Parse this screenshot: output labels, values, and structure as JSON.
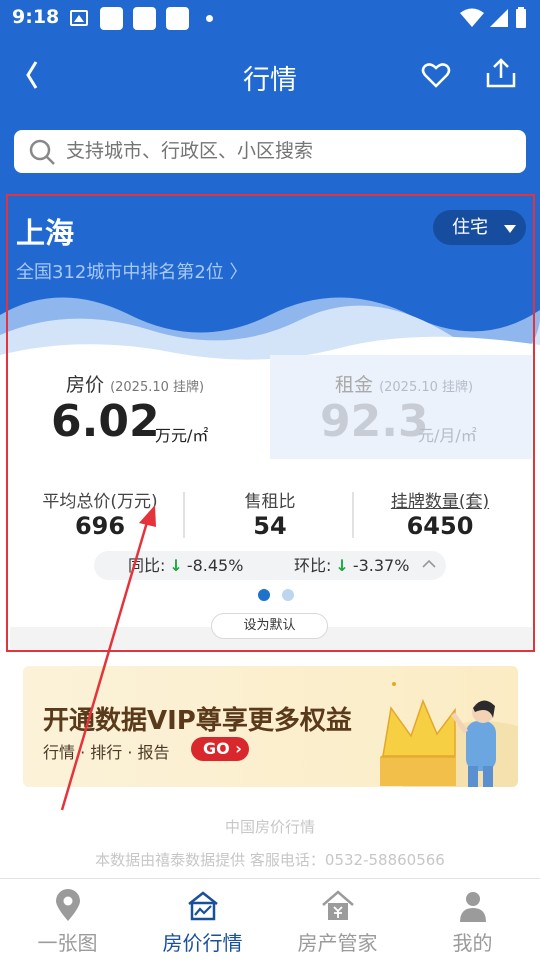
{
  "status_bar": {
    "time": "9:18"
  },
  "nav": {
    "title": "行情"
  },
  "search": {
    "placeholder": "支持城市、行政区、小区搜索"
  },
  "card": {
    "city": "上海",
    "rank_text": "全国312城市中排名第2位 〉",
    "property_type": "住宅",
    "price": {
      "label": "房价",
      "date": "(2025.10 挂牌)",
      "value": "6.02",
      "unit": "万元/㎡"
    },
    "rent": {
      "label": "租金",
      "date": "(2025.10 挂牌)",
      "value": "92.3",
      "unit": "元/月/㎡"
    },
    "stats": [
      {
        "label": "平均总价(万元)",
        "value": "696"
      },
      {
        "label": "售租比",
        "value": "54"
      },
      {
        "label": "挂牌数量(套)",
        "value": "6450"
      }
    ],
    "yoy": {
      "label": "同比:",
      "value": "-8.45%"
    },
    "mom": {
      "label": "环比:",
      "value": "-3.37%"
    },
    "pager": {
      "pages": 2,
      "active": 1
    },
    "set_default": "设为默认"
  },
  "vip_banner": {
    "title_plain": "开通数据VIP",
    "title_highlight": "尊享更多权益",
    "subtitle": "行情 · 排行 · 报告",
    "go": "GO"
  },
  "footer": {
    "name": "中国房价行情",
    "info": "本数据由禧泰数据提供 客服电话：0532-58860566"
  },
  "tabs": [
    {
      "label": "一张图",
      "icon": "location-pin-icon",
      "active": false
    },
    {
      "label": "房价行情",
      "icon": "house-chart-icon",
      "active": true
    },
    {
      "label": "房产管家",
      "icon": "house-yen-icon",
      "active": false
    },
    {
      "label": "我的",
      "icon": "person-icon",
      "active": false
    }
  ],
  "colors": {
    "primary": "#2169d1",
    "highlight_box": "#e5333b",
    "down": "#1aaa3c",
    "tab_active": "#1a4f9c"
  }
}
